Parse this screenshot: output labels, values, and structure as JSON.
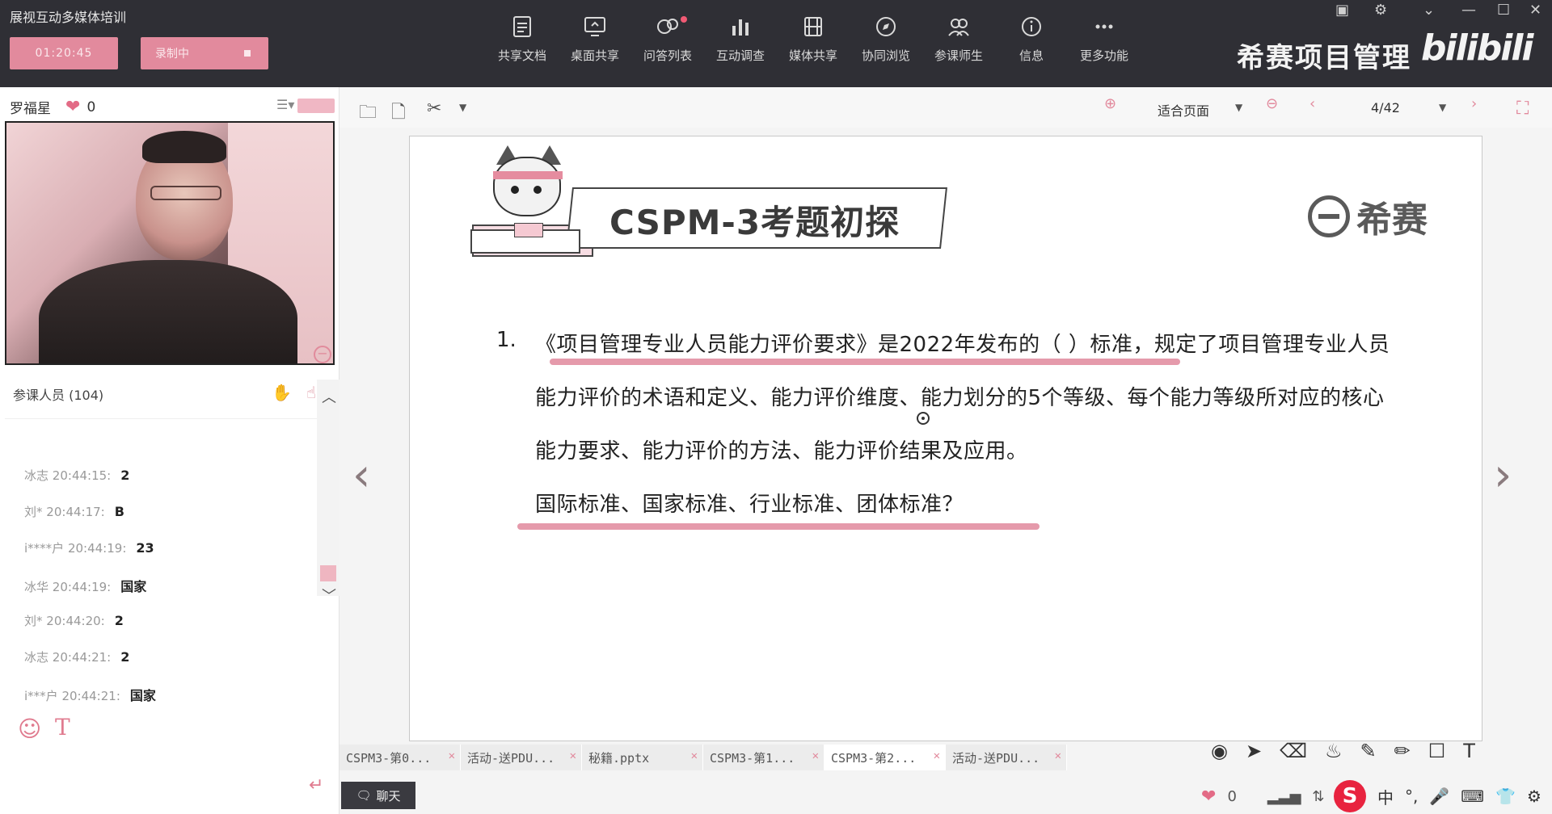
{
  "app": {
    "title": "展视互动多媒体培训",
    "timer": "01:20:45",
    "record_label": "录制中"
  },
  "toolbar": {
    "items": [
      {
        "label": "共享文档",
        "icon": "document-icon"
      },
      {
        "label": "桌面共享",
        "icon": "desktop-icon"
      },
      {
        "label": "问答列表",
        "icon": "qa-icon"
      },
      {
        "label": "互动调查",
        "icon": "chart-icon"
      },
      {
        "label": "媒体共享",
        "icon": "film-icon"
      },
      {
        "label": "协同浏览",
        "icon": "compass-icon"
      },
      {
        "label": "参课师生",
        "icon": "people-icon"
      },
      {
        "label": "信息",
        "icon": "info-icon"
      },
      {
        "label": "更多功能",
        "icon": "more-icon"
      }
    ],
    "brand": "希赛项目管理",
    "bilibili": "bilibili"
  },
  "sidebar": {
    "teacher_name": "罗福星",
    "likes": "0",
    "participants_label": "参课人员 (104)",
    "chat": [
      {
        "user": "冰志",
        "time": "20:44:15:",
        "msg": "2"
      },
      {
        "user": "刘*",
        "time": "20:44:17:",
        "msg": "B"
      },
      {
        "user": "i****户",
        "time": "20:44:19:",
        "msg": "23"
      },
      {
        "user": "冰华",
        "time": "20:44:19:",
        "msg": "国家"
      },
      {
        "user": "刘*",
        "time": "20:44:20:",
        "msg": "2"
      },
      {
        "user": "冰志",
        "time": "20:44:21:",
        "msg": "2"
      },
      {
        "user": "i***户",
        "time": "20:44:21:",
        "msg": "国家"
      }
    ],
    "chat_tab": "聊天"
  },
  "doc_toolbar": {
    "fit_label": "适合页面",
    "page": "4/42"
  },
  "slide": {
    "title": "CSPM-3考题初探",
    "logo_text": "希赛",
    "q_number": "1.",
    "lines": [
      "《项目管理专业人员能力评价要求》是2022年发布的（  ）标准，规定了项目管理专业人员",
      "能力评价的术语和定义、能力评价维度、能力划分的5个等级、每个能力等级所对应的核心",
      "能力要求、能力评价的方法、能力评价结果及应用。",
      "国际标准、国家标准、行业标准、团体标准？"
    ]
  },
  "tabs": [
    {
      "label": "CSPM3-第0..."
    },
    {
      "label": "活动-送PDU..."
    },
    {
      "label": "秘籍.pptx"
    },
    {
      "label": "CSPM3-第1..."
    },
    {
      "label": "CSPM3-第2..."
    },
    {
      "label": "活动-送PDU..."
    }
  ],
  "status": {
    "likes": "0",
    "ime_lang": "中"
  },
  "colors": {
    "accent": "#e28a9d",
    "topbar": "#2f2f35",
    "underline": "#e59aab"
  }
}
